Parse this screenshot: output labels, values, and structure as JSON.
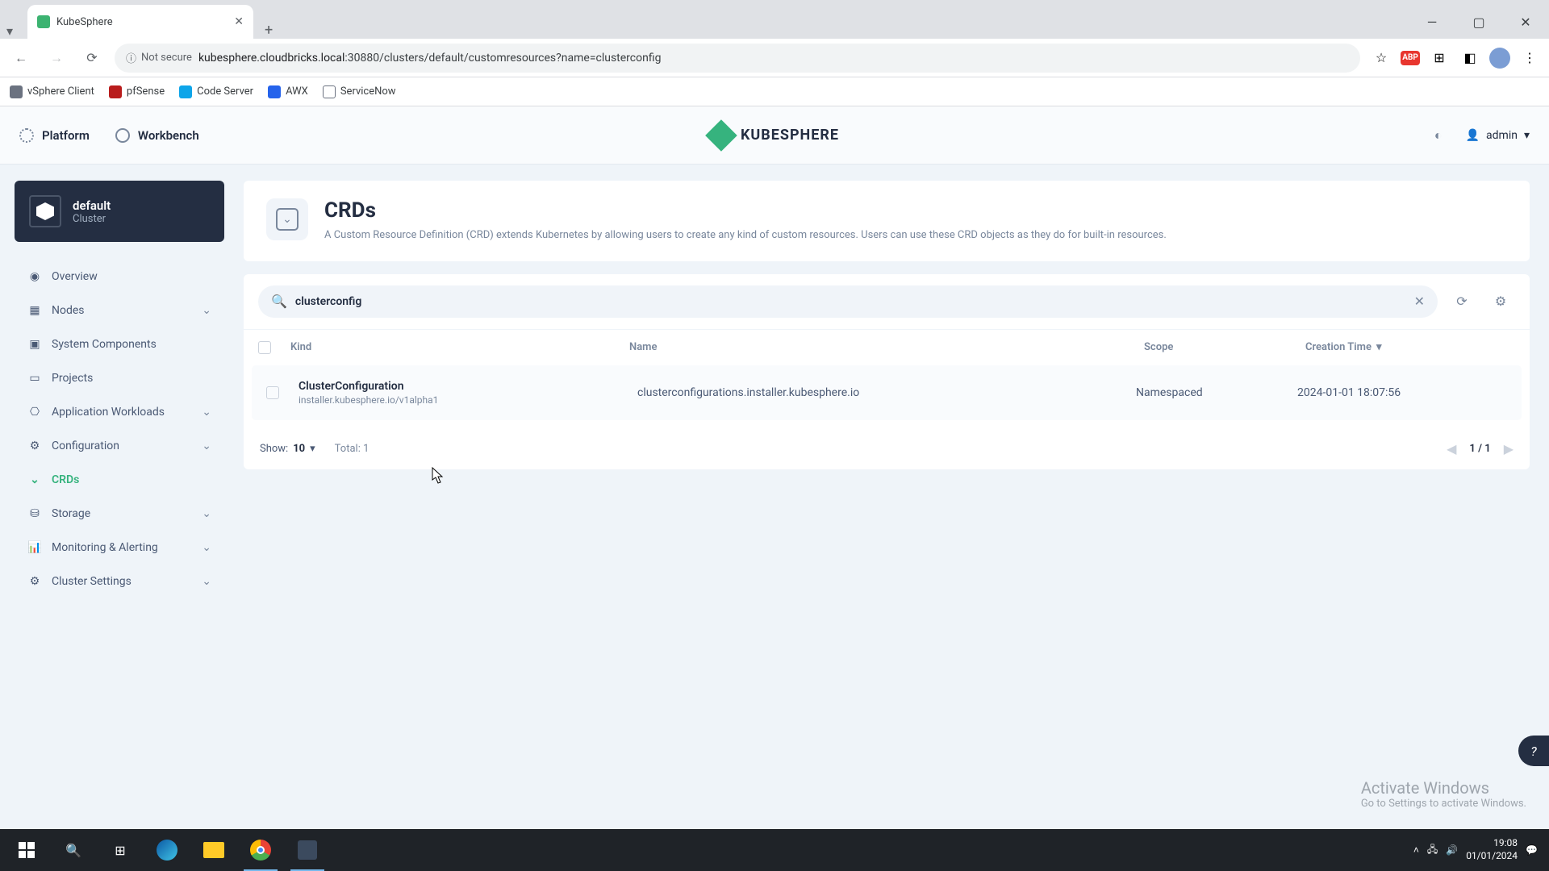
{
  "browser": {
    "tab_title": "KubeSphere",
    "url_host": "kubesphere.cloudbricks.local",
    "url_path": ":30880/clusters/default/customresources?name=clusterconfig",
    "not_secure": "Not secure"
  },
  "bookmarks": [
    {
      "label": "vSphere Client"
    },
    {
      "label": "pfSense"
    },
    {
      "label": "Code Server"
    },
    {
      "label": "AWX"
    },
    {
      "label": "ServiceNow"
    }
  ],
  "header": {
    "platform": "Platform",
    "workbench": "Workbench",
    "logo": "KUBESPHERE",
    "user": "admin"
  },
  "sidebar": {
    "cluster_name": "default",
    "cluster_type": "Cluster",
    "items": [
      {
        "label": "Overview",
        "expandable": false,
        "active": false
      },
      {
        "label": "Nodes",
        "expandable": true,
        "active": false
      },
      {
        "label": "System Components",
        "expandable": false,
        "active": false
      },
      {
        "label": "Projects",
        "expandable": false,
        "active": false
      },
      {
        "label": "Application Workloads",
        "expandable": true,
        "active": false
      },
      {
        "label": "Configuration",
        "expandable": true,
        "active": false
      },
      {
        "label": "CRDs",
        "expandable": false,
        "active": true
      },
      {
        "label": "Storage",
        "expandable": true,
        "active": false
      },
      {
        "label": "Monitoring & Alerting",
        "expandable": true,
        "active": false
      },
      {
        "label": "Cluster Settings",
        "expandable": true,
        "active": false
      }
    ]
  },
  "page": {
    "title": "CRDs",
    "description": "A Custom Resource Definition (CRD) extends Kubernetes by allowing users to create any kind of custom resources. Users can use these CRD objects as they do for built-in resources."
  },
  "search": {
    "value": "clusterconfig"
  },
  "table": {
    "columns": {
      "kind": "Kind",
      "name": "Name",
      "scope": "Scope",
      "time": "Creation Time"
    },
    "rows": [
      {
        "kind_title": "ClusterConfiguration",
        "kind_sub": "installer.kubesphere.io/v1alpha1",
        "name": "clusterconfigurations.installer.kubesphere.io",
        "scope": "Namespaced",
        "time": "2024-01-01 18:07:56"
      }
    ],
    "footer": {
      "show_label": "Show:",
      "show_value": "10",
      "total_label": "Total:",
      "total_value": "1",
      "page": "1 / 1"
    }
  },
  "watermark": {
    "title": "Activate Windows",
    "sub": "Go to Settings to activate Windows."
  },
  "taskbar": {
    "time": "19:08",
    "date": "01/01/2024"
  }
}
